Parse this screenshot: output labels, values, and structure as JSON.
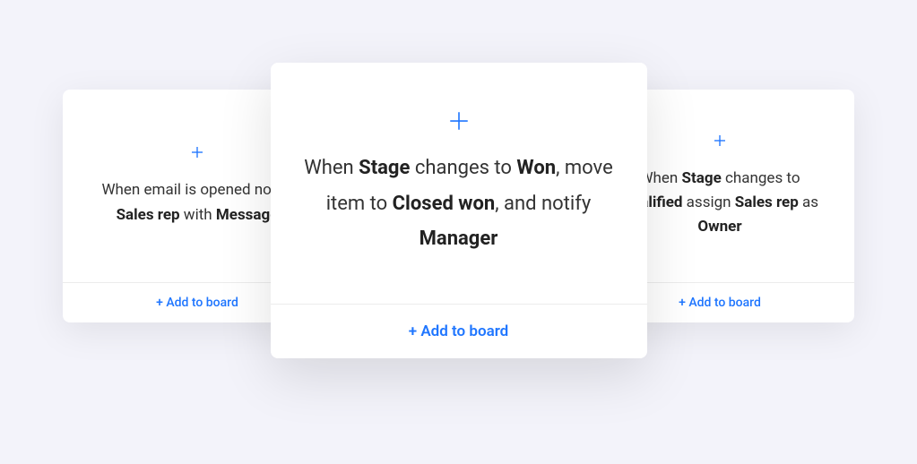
{
  "accent_color": "#1f76ff",
  "add_label": "+ Add to board",
  "cards": {
    "left": {
      "segments": [
        [
          "",
          "When email is opened notify "
        ],
        [
          "b",
          "Sales rep"
        ],
        [
          "",
          " with "
        ],
        [
          "b",
          "Message"
        ]
      ]
    },
    "center": {
      "segments": [
        [
          "",
          "When "
        ],
        [
          "b",
          "Stage"
        ],
        [
          "",
          " changes to "
        ],
        [
          "b",
          "Won"
        ],
        [
          "",
          ", move item to "
        ],
        [
          "b",
          "Closed won"
        ],
        [
          "",
          ", and notify "
        ],
        [
          "b",
          "Manager"
        ]
      ]
    },
    "right": {
      "segments": [
        [
          "",
          "When "
        ],
        [
          "b",
          "Stage"
        ],
        [
          "",
          " changes to "
        ],
        [
          "b",
          "Qualified"
        ],
        [
          "",
          " assign "
        ],
        [
          "b",
          "Sales rep"
        ],
        [
          "",
          " as "
        ],
        [
          "b",
          "Owner"
        ]
      ]
    }
  }
}
